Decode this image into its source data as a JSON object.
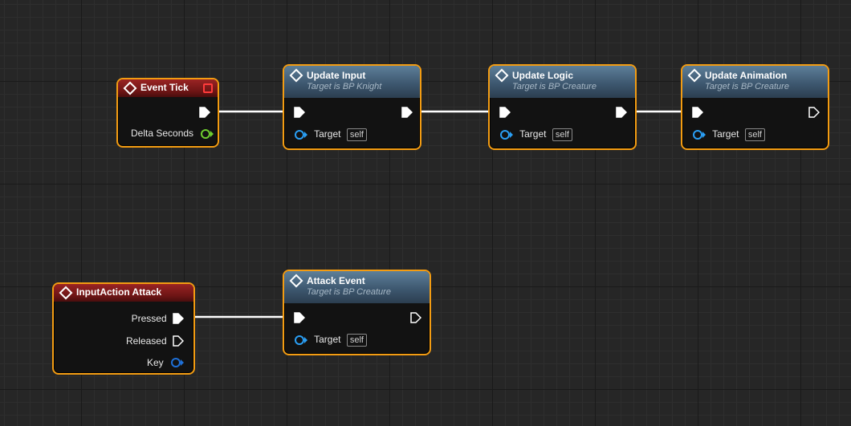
{
  "nodes": {
    "event_tick": {
      "title": "Event Tick",
      "pins": {
        "delta_seconds": "Delta Seconds"
      }
    },
    "update_input": {
      "title": "Update Input",
      "subtitle": "Target is BP Knight",
      "target_label": "Target",
      "target_value": "self"
    },
    "update_logic": {
      "title": "Update Logic",
      "subtitle": "Target is BP Creature",
      "target_label": "Target",
      "target_value": "self"
    },
    "update_animation": {
      "title": "Update Animation",
      "subtitle": "Target is BP Creature",
      "target_label": "Target",
      "target_value": "self"
    },
    "input_action_attack": {
      "title": "InputAction Attack",
      "pins": {
        "pressed": "Pressed",
        "released": "Released",
        "key": "Key"
      }
    },
    "attack_event": {
      "title": "Attack Event",
      "subtitle": "Target is BP Creature",
      "target_label": "Target",
      "target_value": "self"
    }
  },
  "colors": {
    "selection_outline": "#f39c12",
    "event_header": "#8b1a1a",
    "function_header": "#4a6a85",
    "float_pin": "#6fcf2f",
    "object_pin": "#2a9ff5",
    "struct_pin": "#1e70d8",
    "exec_wire": "#ffffff"
  },
  "icons": {
    "function": "function-diamond-icon",
    "delegate": "delegate-square-icon",
    "exec_pin": "exec-arrow-icon"
  }
}
